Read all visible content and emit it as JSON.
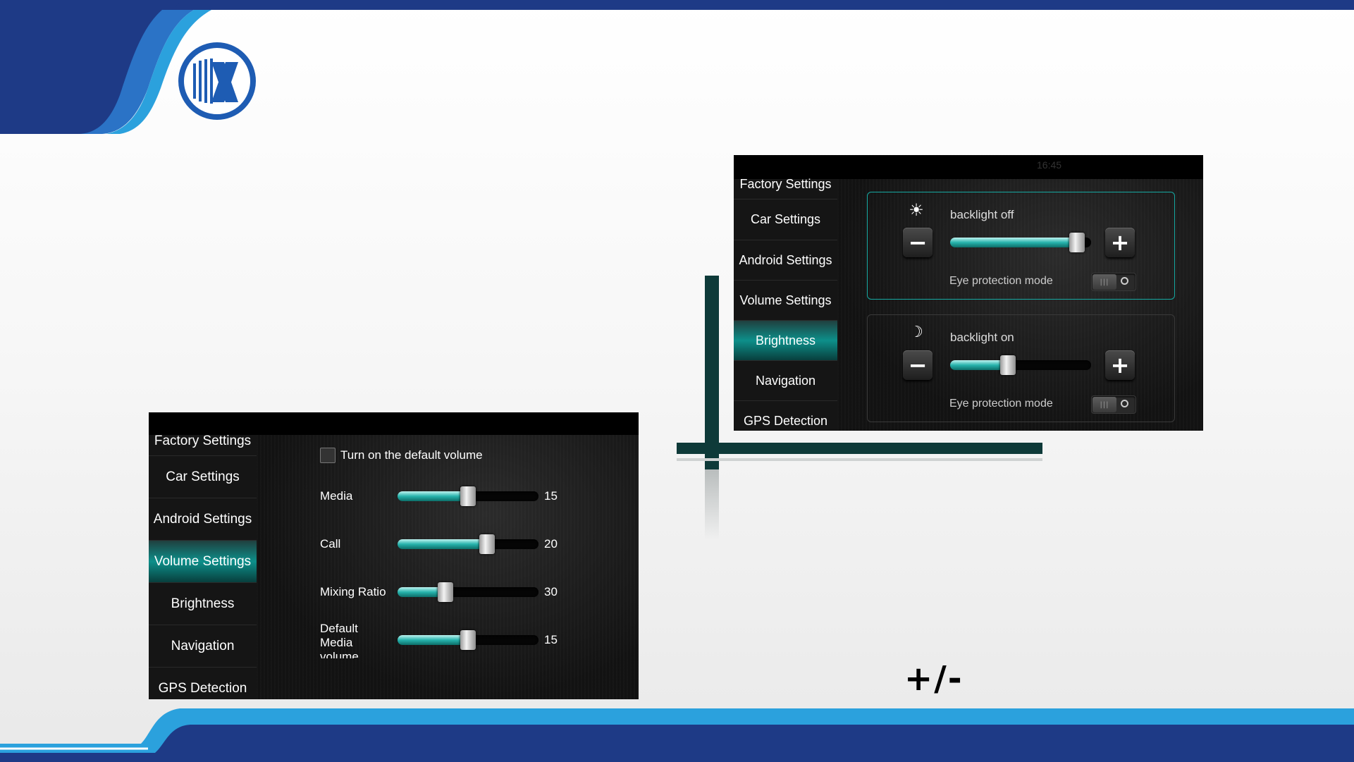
{
  "brand": {
    "logo_letter": "X",
    "colors": {
      "dark_blue": "#1e3a86",
      "mid_blue": "#2b73c6",
      "light_blue": "#2ba1dd",
      "teal": "#13a39c"
    }
  },
  "volume_screen": {
    "sidebar": [
      {
        "label": "Factory Settings",
        "active": false
      },
      {
        "label": "Car Settings",
        "active": false
      },
      {
        "label": "Android Settings",
        "active": false
      },
      {
        "label": "Volume Settings",
        "active": true
      },
      {
        "label": "Brightness",
        "active": false
      },
      {
        "label": "Navigation",
        "active": false
      },
      {
        "label": "GPS Detection",
        "active": false
      }
    ],
    "default_volume_checkbox": {
      "label": "Turn on the default volume",
      "checked": false
    },
    "sliders": [
      {
        "label": "Media",
        "value": "15",
        "level": 0.5
      },
      {
        "label": "Call",
        "value": "20",
        "level": 0.65
      },
      {
        "label": "Mixing Ratio",
        "value": "30",
        "level": 0.32
      },
      {
        "label_line1": "Default",
        "label_line2": "Media",
        "label_line3": "volume",
        "value": "15",
        "level": 0.5
      }
    ]
  },
  "brightness_screen": {
    "status_bar": {
      "time": "16:45"
    },
    "sidebar": [
      {
        "label": "Factory Settings",
        "active": false
      },
      {
        "label": "Car Settings",
        "active": false
      },
      {
        "label": "Android Settings",
        "active": false
      },
      {
        "label": "Volume Settings",
        "active": false
      },
      {
        "label": "Brightness",
        "active": true
      },
      {
        "label": "Navigation",
        "active": false
      },
      {
        "label": "GPS Detection",
        "active": false
      }
    ],
    "groups": [
      {
        "icon": "sun-icon",
        "title": "backlight off",
        "level": 0.95,
        "eye_label": "Eye protection mode",
        "eye_on": false,
        "minus": "−",
        "plus": "+"
      },
      {
        "icon": "moon-icon",
        "title": "backlight on",
        "level": 0.4,
        "eye_label": "Eye protection mode",
        "eye_on": false,
        "minus": "−",
        "plus": "+"
      }
    ]
  },
  "annotation": {
    "plus_minus": "+/-"
  }
}
